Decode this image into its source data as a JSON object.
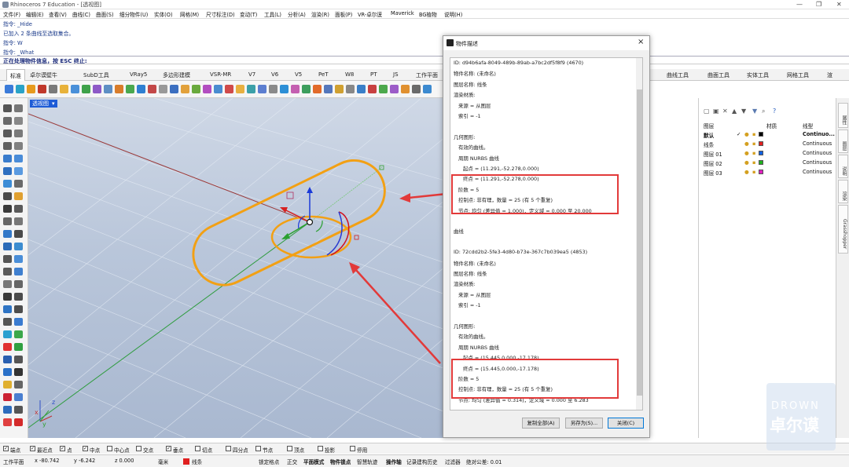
{
  "window": {
    "title": "Rhinoceros 7 Education - [透视图]",
    "min": "—",
    "max": "❐",
    "close": "✕"
  },
  "menu": [
    "文件(F)",
    "编辑(E)",
    "查看(V)",
    "曲线(C)",
    "曲面(S)",
    "细分物件(U)",
    "实体(O)",
    "网格(M)",
    "尺寸标注(D)",
    "变动(T)",
    "工具(L)",
    "分析(A)",
    "渲染(R)",
    "面板(P)",
    "VR-卓尔谟",
    "Maverick",
    "BG植物",
    "说明(H)"
  ],
  "command_history": [
    "指令: _Hide",
    "已加入 2 条曲线至选取集合。",
    "指令: W",
    "指令: _What"
  ],
  "prompt": "正在处理物件信息，按 ESC 终止:",
  "tabs": [
    "标准",
    "卓尔谟壁牛",
    "SubD工具",
    "VRay5",
    "多边形建模",
    "VSR-MR",
    "V7",
    "V6",
    "V5",
    "PeT",
    "W8",
    "PT",
    "JS",
    "工作平面"
  ],
  "tabs_right": [
    "曲线工具",
    "曲面工具",
    "实体工具",
    "网格工具",
    "渲"
  ],
  "viewport": {
    "label": "透视图",
    "label_arrow": "▾",
    "axis_x": "x",
    "axis_y": "y",
    "axis_z": "z"
  },
  "dialog": {
    "title": "物件描述",
    "lines": [
      "ID: d94b6afa-8049-489b-89ab-a7bc2df5f8f9 (4670)",
      "物件名称: (未命名)",
      "图层名称: 线条",
      "渲染材质:",
      "  来源 = 从图层",
      "  索引 = -1",
      "",
      "几何图形:",
      "  有效的曲线。",
      "  周期 NURBS 曲线",
      "    起点 = (11.291,-52.278,0.000)",
      "    终点 = (11.291,-52.278,0.000)",
      "  阶数 = 5",
      "  控制点: 非有理，数量 = 25 (有 5 个重复)",
      "  节点: 均匀 (差异值 = 1.000)，定义域 = 0.000 至 20.000",
      "",
      "曲线",
      "",
      "ID: 72cdd2b2-5fe3-4d80-b73e-367c7b039ea5 (4853)",
      "物件名称: (未命名)",
      "图层名称: 线条",
      "渲染材质:",
      "  来源 = 从图层",
      "  索引 = -1",
      "",
      "几何图形:",
      "  有效的曲线。",
      "  周期 NURBS 曲线",
      "    起点 = (15.445,0.000,-17.178)",
      "    终点 = (15.445,0.000,-17.178)",
      "  阶数 = 5",
      "  控制点: 非有理，数量 = 25 (有 5 个重复)",
      "  节点: 均匀 (差异值 = 0.314)，定义域 = 0.000 至 6.283"
    ],
    "btn_copy": "复制全部(A)",
    "btn_saveas": "另存为(S)...",
    "btn_close": "关闭(C)"
  },
  "layers": {
    "headers": [
      "图层",
      "材质",
      "线型"
    ],
    "rows": [
      {
        "name": "默认",
        "check": "✓",
        "color": "#000000",
        "linetype": "Continuo..."
      },
      {
        "name": "线条",
        "check": "",
        "color": "#e02020",
        "linetype": "Continuous"
      },
      {
        "name": "图层 01",
        "check": "",
        "color": "#1060e0",
        "linetype": "Continuous"
      },
      {
        "name": "图层 02",
        "check": "",
        "color": "#20b020",
        "linetype": "Continuous"
      },
      {
        "name": "图层 03",
        "check": "",
        "color": "#e020c0",
        "linetype": "Continuous"
      }
    ],
    "side_tabs": [
      "属性",
      "图层",
      "说明",
      "渲染",
      "Grasshopper"
    ]
  },
  "osnap": [
    "端点",
    "最近点",
    "点",
    "中点",
    "中心点",
    "交点",
    "垂点",
    "切点",
    "四分点",
    "节点",
    "顶点",
    "投影",
    "停用"
  ],
  "osnap_checked": [
    true,
    true,
    true,
    true,
    false,
    false,
    true,
    false,
    false,
    false,
    false,
    false,
    false
  ],
  "status": {
    "cplane": "工作平面",
    "x": "x  -80.742",
    "y": "y  -6.242",
    "z": "z  0.000",
    "unit": "毫米",
    "layer": "线条",
    "layer_color": "#e02020",
    "items": [
      "锁定格点",
      "正交",
      "平面模式",
      "物件锁点",
      "智慧轨迹",
      "操作轴",
      "记录建构历史",
      "过滤器",
      "绝对公差: 0.01"
    ]
  },
  "watermark": {
    "line1": "DROWN",
    "line2": "卓尔谟"
  }
}
